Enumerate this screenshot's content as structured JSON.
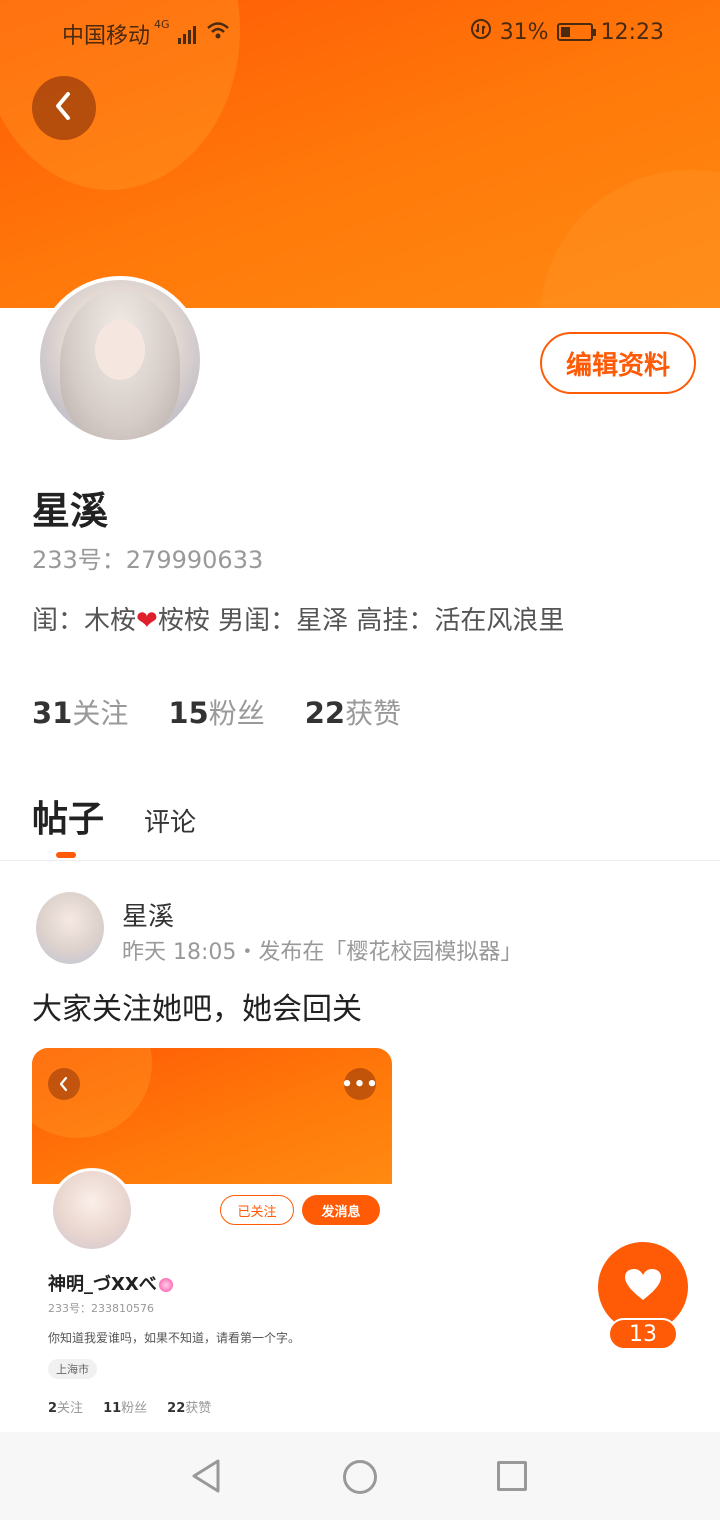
{
  "status_bar": {
    "carrier": "中国移动",
    "network": "4G",
    "battery": "31%",
    "time": "12:23"
  },
  "profile": {
    "edit_label": "编辑资料",
    "name": "星溪",
    "uid": "233号：279990633",
    "bio_part1": "闺：木桉",
    "bio_heart": "❤",
    "bio_part2": "桉桉 男闺：星泽 高挂：活在风浪里",
    "stats": [
      {
        "num": "31",
        "label": "关注"
      },
      {
        "num": "15",
        "label": "粉丝"
      },
      {
        "num": "22",
        "label": "获赞"
      }
    ]
  },
  "tabs": [
    {
      "label": "帖子"
    },
    {
      "label": "评论"
    }
  ],
  "post": {
    "author": "星溪",
    "meta": "昨天 18:05・发布在「樱花校园模拟器」",
    "text": "大家关注她吧，她会回关",
    "image": {
      "more_glyph": "•••",
      "followed_label": "已关注",
      "message_label": "发消息",
      "name": "神明_づXXべ",
      "uid": "233号：233810576",
      "bio": "你知道我爱谁吗，如果不知道，请看第一个字。",
      "location": "上海市",
      "stats": [
        {
          "num": "2",
          "label": "关注"
        },
        {
          "num": "11",
          "label": "粉丝"
        },
        {
          "num": "22",
          "label": "获赞"
        }
      ]
    }
  },
  "like": {
    "count": "13"
  },
  "icons": {
    "back": "chevron-left-icon",
    "like": "heart-icon",
    "nav": [
      "triangle-back-icon",
      "circle-home-icon",
      "square-recents-icon"
    ]
  },
  "colors": {
    "accent": "#ff5a05"
  }
}
